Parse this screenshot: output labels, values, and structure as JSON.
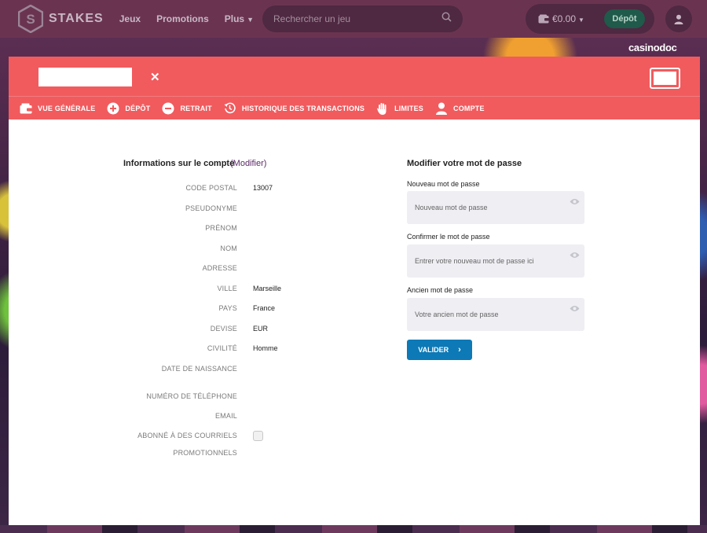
{
  "brand": {
    "name": "STAKES"
  },
  "nav": {
    "links": [
      "Jeux",
      "Promotions",
      "Plus"
    ],
    "search_placeholder": "Rechercher un jeu",
    "balance": "€0.00",
    "deposit_label": "Dépôt"
  },
  "watermark": "casinodoc",
  "tabs": [
    {
      "label": "VUE GÉNÉRALE",
      "icon": "wallet-icon"
    },
    {
      "label": "DÉPÔT",
      "icon": "plus-circle-icon"
    },
    {
      "label": "RETRAIT",
      "icon": "minus-circle-icon"
    },
    {
      "label": "HISTORIQUE DES TRANSACTIONS",
      "icon": "history-icon"
    },
    {
      "label": "LIMITES",
      "icon": "hand-icon"
    },
    {
      "label": "COMPTE",
      "icon": "user-icon"
    }
  ],
  "account": {
    "title": "Informations sur le compte",
    "modify_label": "(Modifier)",
    "fields": [
      {
        "label": "CODE POSTAL",
        "value": "13007"
      },
      {
        "label": "PSEUDONYME",
        "value": ""
      },
      {
        "label": "PRÉNOM",
        "value": ""
      },
      {
        "label": "NOM",
        "value": ""
      },
      {
        "label": "ADRESSE",
        "value": ""
      },
      {
        "label": "VILLE",
        "value": "Marseille"
      },
      {
        "label": "PAYS",
        "value": "France"
      },
      {
        "label": "DEVISE",
        "value": "EUR"
      },
      {
        "label": "CIVILITÉ",
        "value": "Homme"
      },
      {
        "label": "DATE DE NAISSANCE",
        "value": ""
      },
      {
        "label": "NUMÉRO DE TÉLÉPHONE",
        "value": ""
      },
      {
        "label": "EMAIL",
        "value": ""
      }
    ],
    "newsletter_label_line1": "ABONNÉ À DES COURRIELS",
    "newsletter_label_line2": "PROMOTIONNELS",
    "newsletter_checked": false
  },
  "password": {
    "title": "Modifier votre mot de passe",
    "new_label": "Nouveau mot de passe",
    "new_placeholder": "Nouveau mot de passe",
    "confirm_label": "Confirmer le mot de passe",
    "confirm_placeholder": "Entrer votre nouveau mot de passe ici",
    "old_label": "Ancien mot de passe",
    "old_placeholder": "Votre ancien mot de passe",
    "submit_label": "VALIDER"
  },
  "colors": {
    "header_red": "#f15b5e",
    "nav_purple": "#6a3450",
    "submit_blue": "#0d79b6",
    "deposit_green": "#1f5a4a"
  }
}
